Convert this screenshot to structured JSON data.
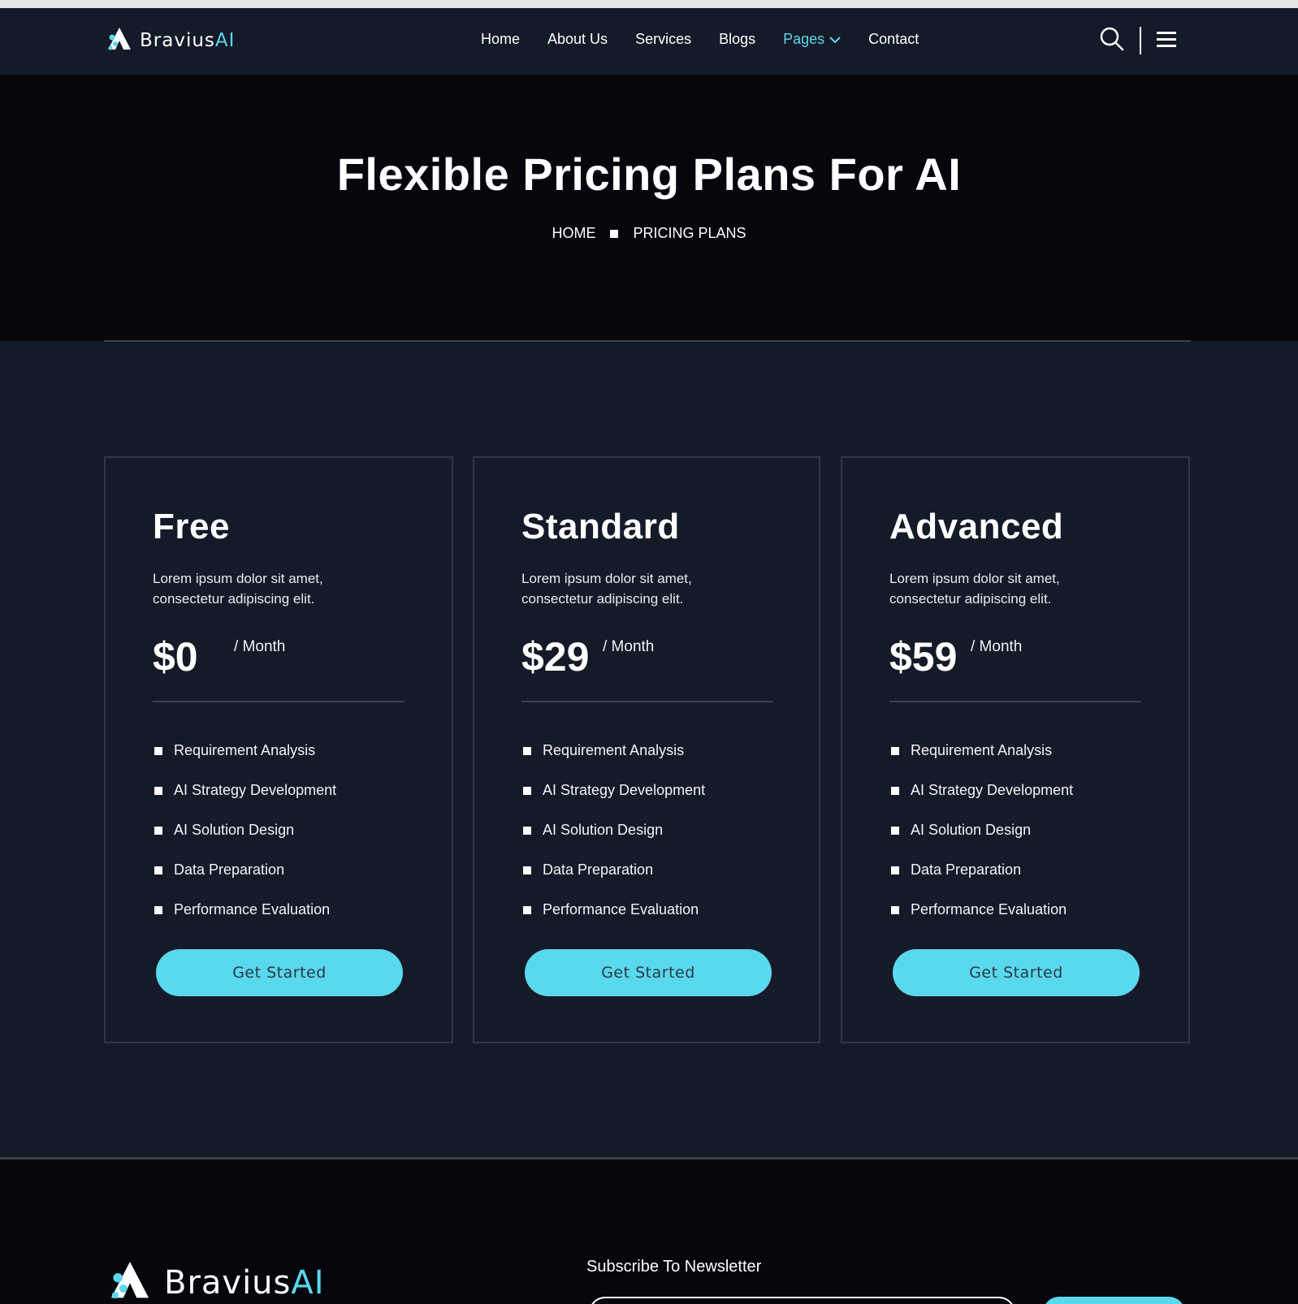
{
  "brand": {
    "name_main": "Bravius",
    "name_accent": "AI",
    "logo_icon": "bravius-logo-icon",
    "accent_color": "#5ad8ee"
  },
  "nav": {
    "links": [
      {
        "label": "Home"
      },
      {
        "label": "About Us"
      },
      {
        "label": "Services"
      },
      {
        "label": "Blogs"
      },
      {
        "label": "Pages",
        "active": true
      },
      {
        "label": "Contact"
      }
    ],
    "tools": [
      "search-icon",
      "menu-icon"
    ]
  },
  "hero": {
    "title": "Flexible Pricing Plans For AI",
    "breadcrumb": {
      "home": "HOME",
      "current": "PRICING PLANS"
    }
  },
  "plans": [
    {
      "name": "Free",
      "description": "Lorem ipsum dolor sit amet, consectetur adipiscing elit.",
      "price": "$0",
      "period": "/ Month",
      "features": [
        "Requirement Analysis",
        "AI Strategy Development",
        "AI Solution Design",
        "Data Preparation",
        "Performance Evaluation"
      ],
      "cta": "Get Started"
    },
    {
      "name": "Standard",
      "description": "Lorem ipsum dolor sit amet, consectetur adipiscing elit.",
      "price": "$29",
      "period": "/ Month",
      "features": [
        "Requirement Analysis",
        "AI Strategy Development",
        "AI Solution Design",
        "Data Preparation",
        "Performance Evaluation"
      ],
      "cta": "Get Started"
    },
    {
      "name": "Advanced",
      "description": "Lorem ipsum dolor sit amet, consectetur adipiscing elit.",
      "price": "$59",
      "period": "/ Month",
      "features": [
        "Requirement Analysis",
        "AI Strategy Development",
        "AI Solution Design",
        "Data Preparation",
        "Performance Evaluation"
      ],
      "cta": "Get Started"
    }
  ],
  "footer": {
    "brand_main": "Bravius",
    "brand_accent": "AI",
    "newsletter_label": "Subscribe To Newsletter"
  }
}
